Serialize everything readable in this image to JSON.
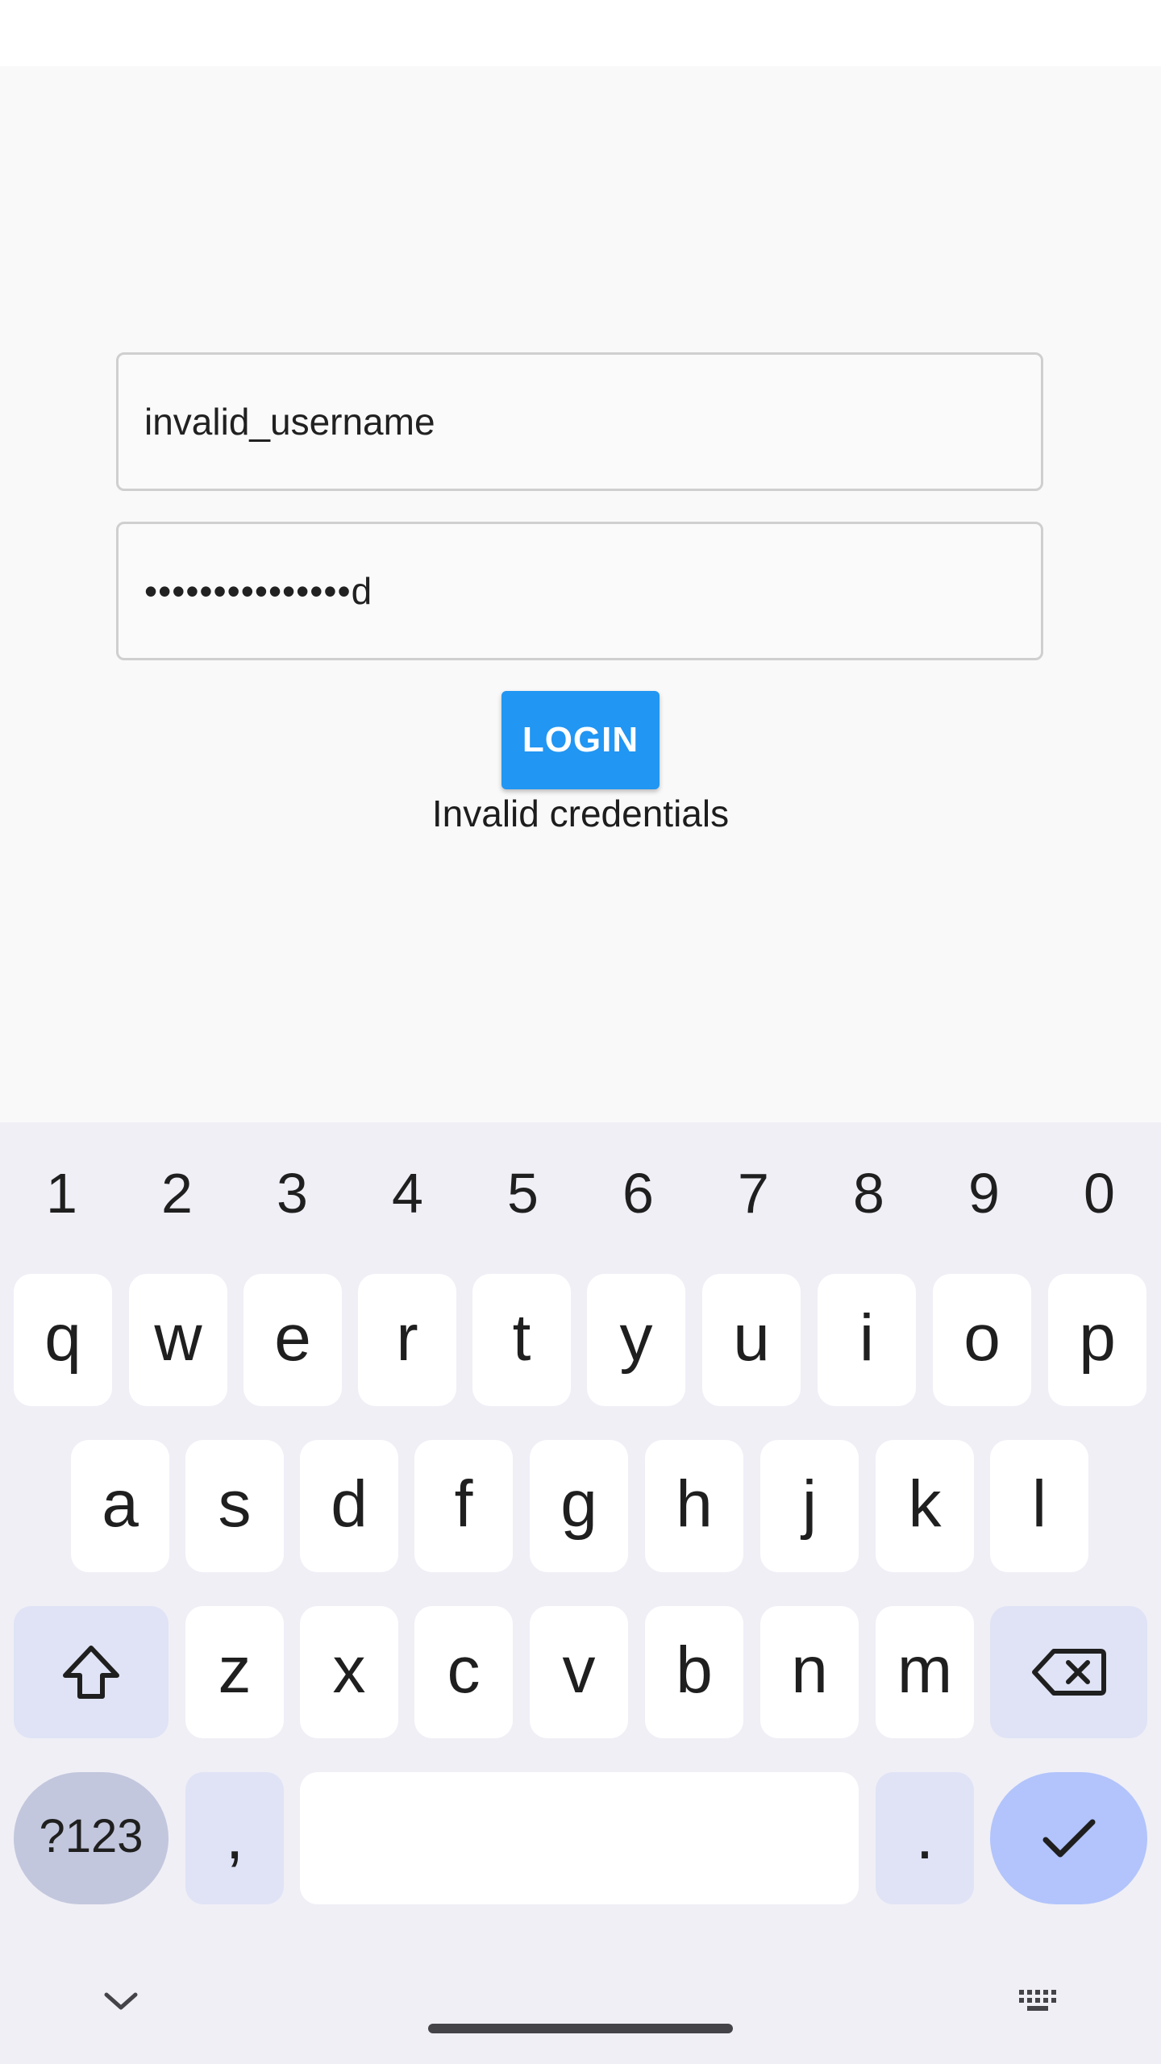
{
  "login": {
    "username_value": "invalid_username",
    "password_value": "•••••••••••••••d",
    "login_label": "LOGIN",
    "error_message": "Invalid credentials",
    "accent_color": "#2196f3"
  },
  "keyboard": {
    "number_row": [
      "1",
      "2",
      "3",
      "4",
      "5",
      "6",
      "7",
      "8",
      "9",
      "0"
    ],
    "row1": [
      "q",
      "w",
      "e",
      "r",
      "t",
      "y",
      "u",
      "i",
      "o",
      "p"
    ],
    "row2": [
      "a",
      "s",
      "d",
      "f",
      "g",
      "h",
      "j",
      "k",
      "l"
    ],
    "row3": [
      "z",
      "x",
      "c",
      "v",
      "b",
      "n",
      "m"
    ],
    "symbols_label": "?123",
    "comma_label": ",",
    "period_label": ".",
    "icons": {
      "shift": "shift-icon",
      "backspace": "backspace-icon",
      "enter": "checkmark-icon",
      "collapse": "chevron-down-icon",
      "switch_keyboard": "keyboard-icon"
    }
  }
}
